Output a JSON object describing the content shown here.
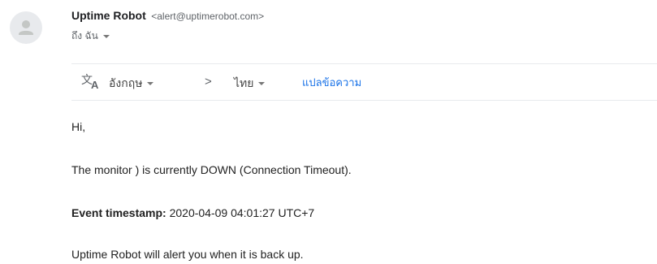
{
  "icons": {
    "avatar": "default-user-avatar-icon",
    "translate": "translate-icon",
    "lang_from_dropdown": "caret-down-icon",
    "separator": "chevron-right-icon",
    "lang_to_dropdown": "caret-down-icon",
    "recipient_dropdown": "caret-down-icon"
  },
  "colors": {
    "link": "#1a73e8",
    "secondary_text": "#5f6368",
    "divider": "#e8eaed",
    "avatar_bg": "#e8eaed"
  },
  "header": {
    "sender_name": "Uptime Robot",
    "sender_email": "<alert@uptimerobot.com>",
    "recipient": "ถึง ฉัน"
  },
  "translate_bar": {
    "source_language": "อังกฤษ",
    "separator": ">",
    "target_language": "ไทย",
    "action_label": "แปลข้อความ"
  },
  "message": {
    "greeting": "Hi,",
    "status_line": "The monitor ) is currently DOWN (Connection Timeout).",
    "timestamp_label": "Event timestamp:",
    "timestamp_value": "2020-04-09 04:01:27 UTC+7",
    "closing_line": "Uptime Robot will alert you when it is back up."
  }
}
